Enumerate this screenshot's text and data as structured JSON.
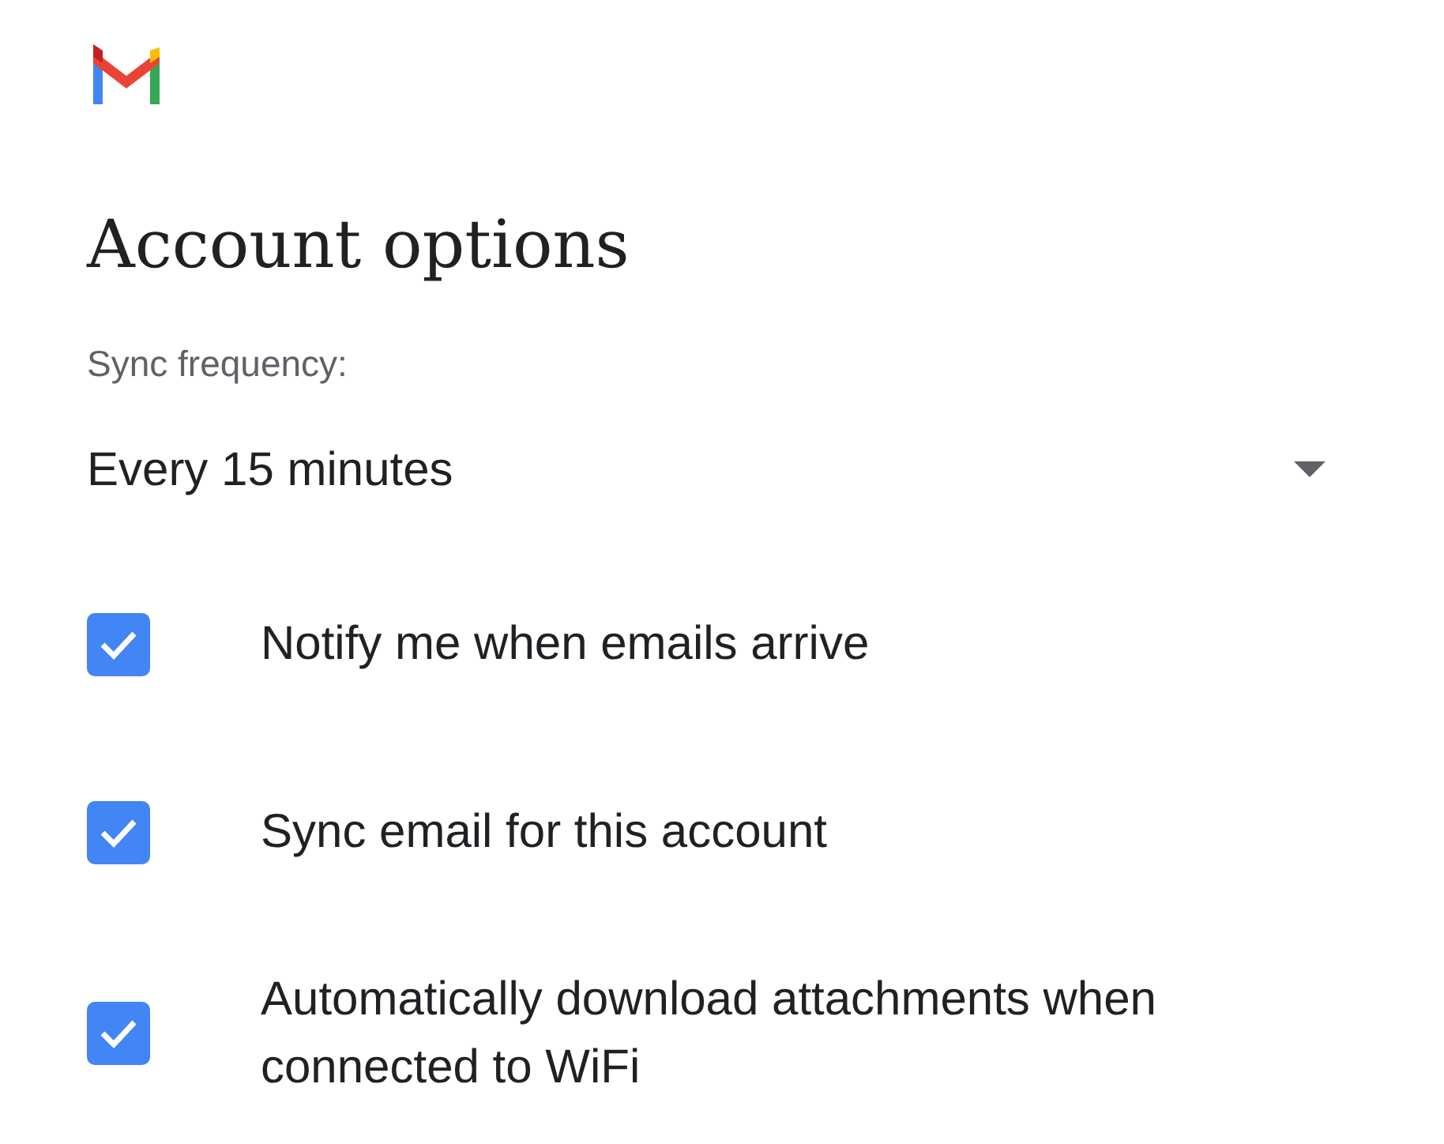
{
  "title": "Account options",
  "sync": {
    "label": "Sync frequency:",
    "value": "Every 15 minutes"
  },
  "options": [
    {
      "label": "Notify me when emails arrive",
      "checked": true
    },
    {
      "label": "Sync email for this account",
      "checked": true
    },
    {
      "label": "Automatically download attachments when connected to WiFi",
      "checked": true
    }
  ]
}
